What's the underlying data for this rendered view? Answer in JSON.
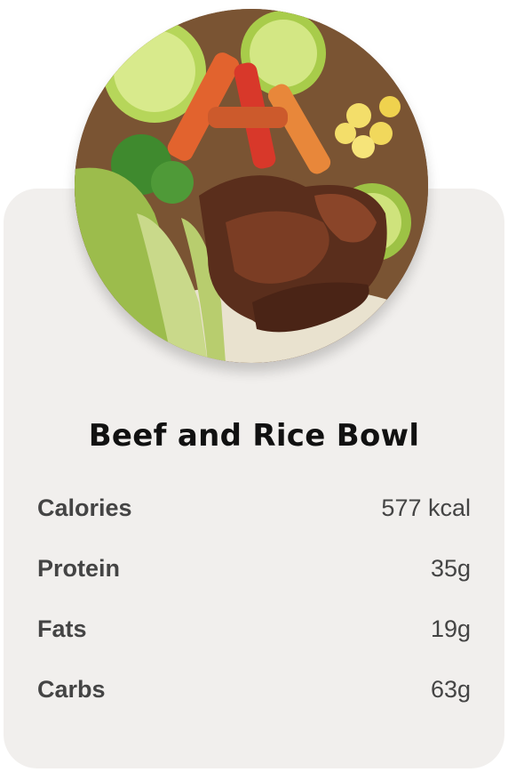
{
  "dish": {
    "image_icon": "beef-rice-bowl-photo",
    "title": "Beef and Rice Bowl"
  },
  "nutrition": [
    {
      "label": "Calories",
      "value": "577 kcal"
    },
    {
      "label": "Protein",
      "value": "35g"
    },
    {
      "label": "Fats",
      "value": "19g"
    },
    {
      "label": "Carbs",
      "value": "63g"
    }
  ],
  "colors": {
    "card_background": "#f1efed",
    "label_text": "#444444",
    "title_text": "#111111"
  }
}
